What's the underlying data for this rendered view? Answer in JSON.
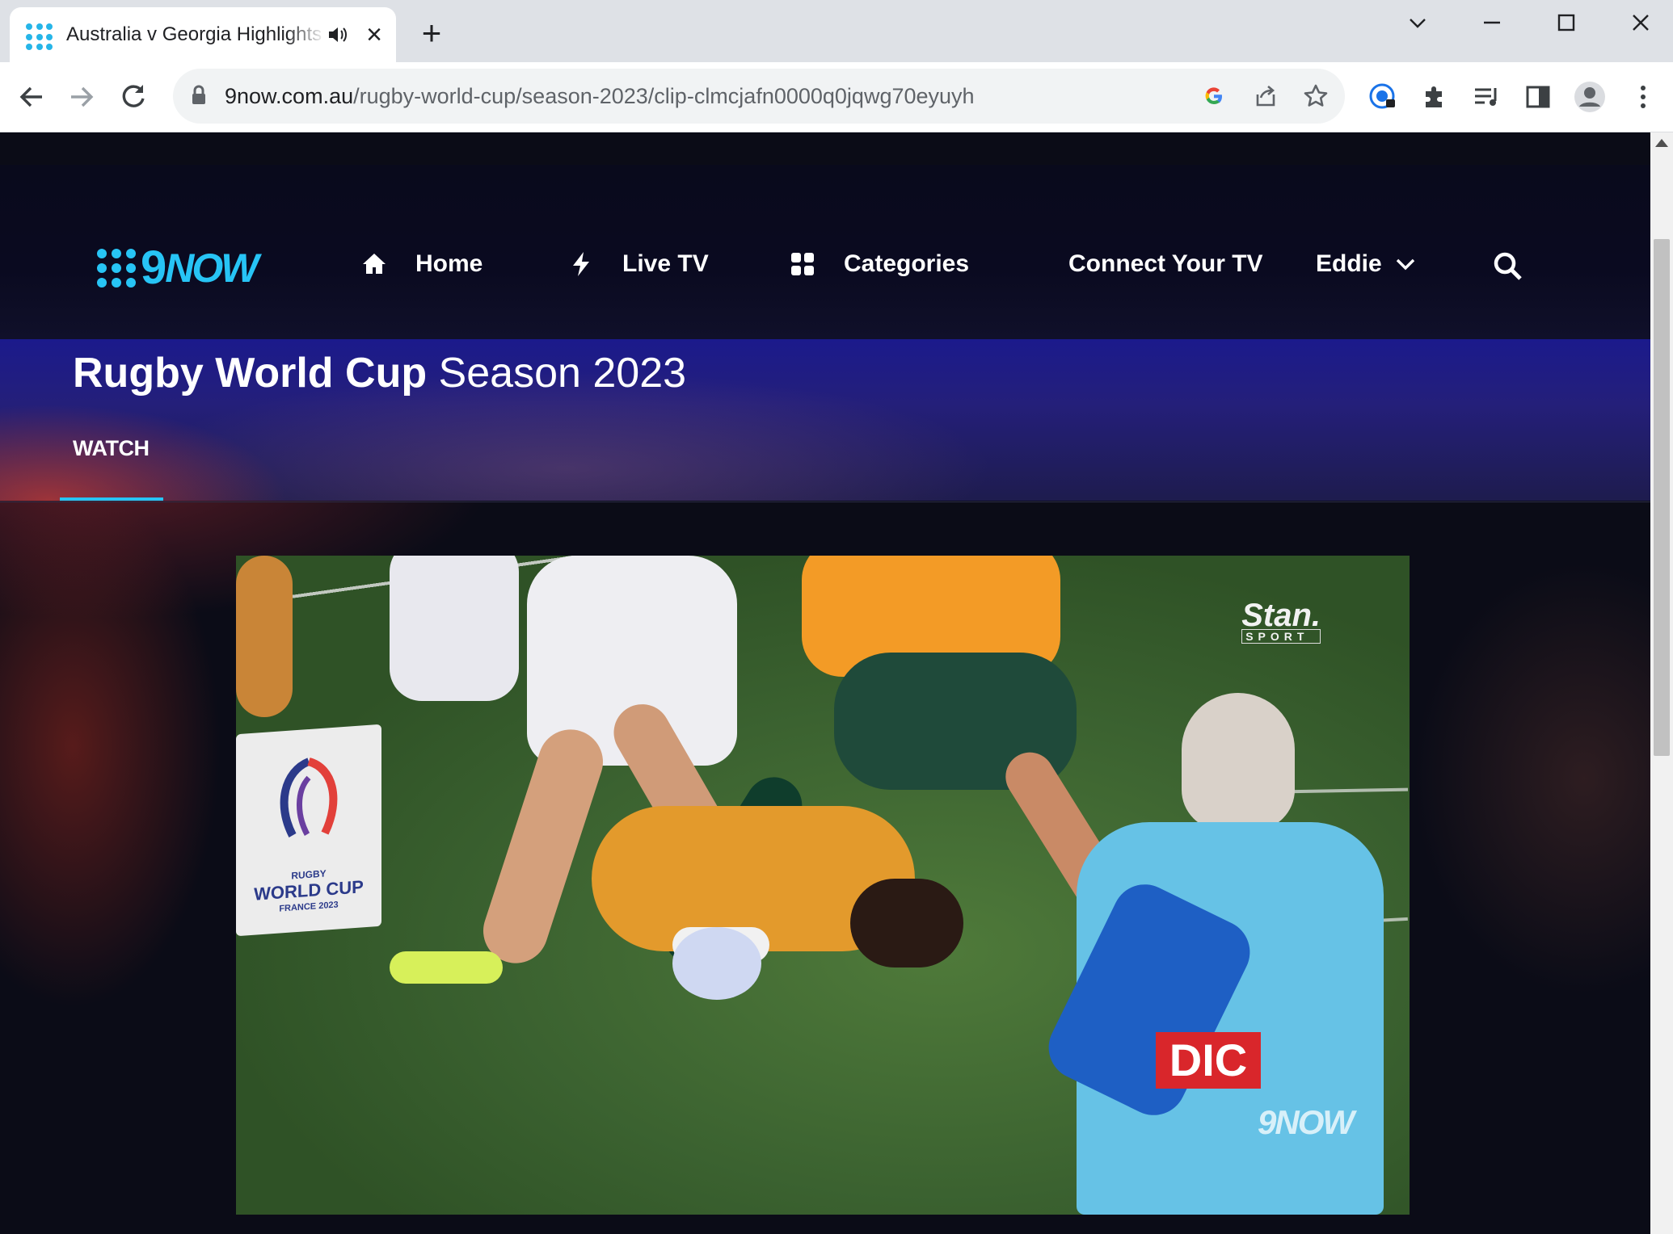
{
  "browser": {
    "tab_title": "Australia v Georgia Highlights",
    "url_host": "9now.com.au",
    "url_path": "/rugby-world-cup/season-2023/clip-clmcjafn0000q0jqwg70eyuyh"
  },
  "nav": {
    "logo_nine": "9",
    "logo_now": "NOW",
    "items": [
      {
        "label": "Home",
        "icon": "home-icon"
      },
      {
        "label": "Live TV",
        "icon": "lightning-icon"
      },
      {
        "label": "Categories",
        "icon": "grid-icon"
      }
    ],
    "connect_tv": "Connect Your TV",
    "user": "Eddie"
  },
  "show": {
    "title_bold": "Rugby World Cup",
    "title_season": "Season 2023",
    "tab_watch": "WATCH"
  },
  "video": {
    "broadcaster": "Stan.",
    "broadcaster_sub": "SPORT",
    "watermark": "9NOW",
    "board_text_line1": "RUGBY",
    "board_text_line2": "WORLD CUP",
    "board_text_line3": "FRANCE 2023",
    "vest_text": "DIC"
  },
  "colors": {
    "accent": "#27c4f5",
    "nav_bg": "#090a1c",
    "banner": "#1b1a8c"
  }
}
